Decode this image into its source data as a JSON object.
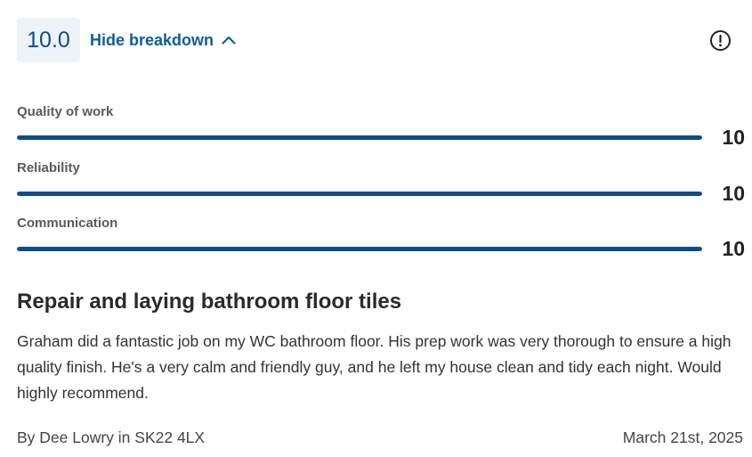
{
  "rating": {
    "overall": "10.0",
    "toggle_label": "Hide breakdown"
  },
  "breakdown": [
    {
      "label": "Quality of work",
      "value": "10",
      "fill_percent": 100
    },
    {
      "label": "Reliability",
      "value": "10",
      "fill_percent": 100
    },
    {
      "label": "Communication",
      "value": "10",
      "fill_percent": 100
    }
  ],
  "review": {
    "title": "Repair and laying bathroom floor tiles",
    "body": "Graham did a fantastic job on my WC bathroom floor. His prep work was very thorough to ensure a high quality finish. He's a very calm and friendly guy, and he left my house clean and tidy each night. Would highly recommend.",
    "author": "By Dee Lowry in SK22 4LX",
    "date": "March 21st, 2025"
  },
  "icons": {
    "toggle": "chevron-up-icon",
    "info": "exclamation-circle-icon"
  },
  "colors": {
    "accent": "#0d4d8c",
    "score_bg": "#eef3f8"
  }
}
